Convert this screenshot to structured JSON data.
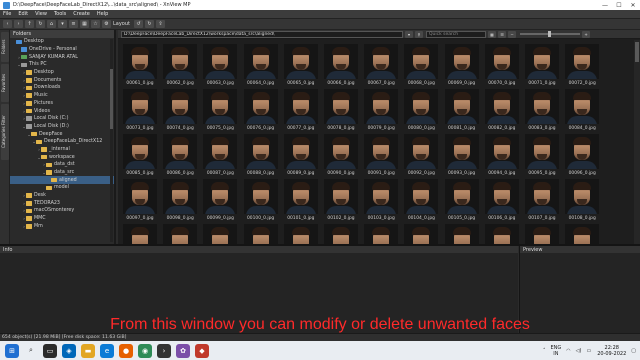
{
  "window": {
    "title": "D:\\DeepFace\\DeepFaceLab_DirectX12\\...\\data_src\\aligned\\ - XnView MP",
    "minimize": "—",
    "maximize": "☐",
    "close": "✕"
  },
  "app_tab": "Browser",
  "menu": [
    "File",
    "Edit",
    "View",
    "Tools",
    "Create",
    "Help"
  ],
  "toolbar": {
    "layout_label": "Layout"
  },
  "side_tabs": [
    "Folders",
    "Favorites",
    "Categories Filter"
  ],
  "folders_panel": {
    "title": "Folders",
    "tree": [
      {
        "label": "Desktop",
        "level": 0,
        "icon": "desktop-icon",
        "arrow": "",
        "selected": false
      },
      {
        "label": "OneDrive - Personal",
        "level": 1,
        "icon": "cloud-icon",
        "arrow": "",
        "selected": false
      },
      {
        "label": "SANJAY KUMAR ATAL",
        "level": 1,
        "icon": "user-folder-icon",
        "arrow": "›",
        "selected": false
      },
      {
        "label": "This PC",
        "level": 1,
        "icon": "computer-icon",
        "arrow": "⌄",
        "selected": false
      },
      {
        "label": "Desktop",
        "level": 2,
        "icon": "folder-icon",
        "arrow": "›",
        "selected": false
      },
      {
        "label": "Documents",
        "level": 2,
        "icon": "folder-icon",
        "arrow": "›",
        "selected": false
      },
      {
        "label": "Downloads",
        "level": 2,
        "icon": "folder-icon",
        "arrow": "›",
        "selected": false
      },
      {
        "label": "Music",
        "level": 2,
        "icon": "folder-icon",
        "arrow": "›",
        "selected": false
      },
      {
        "label": "Pictures",
        "level": 2,
        "icon": "folder-icon",
        "arrow": "›",
        "selected": false
      },
      {
        "label": "Videos",
        "level": 2,
        "icon": "folder-icon",
        "arrow": "›",
        "selected": false
      },
      {
        "label": "Local Disk (C:)",
        "level": 2,
        "icon": "drive-icon",
        "arrow": "›",
        "selected": false
      },
      {
        "label": "Local Disk (D:)",
        "level": 2,
        "icon": "drive-icon",
        "arrow": "⌄",
        "selected": false
      },
      {
        "label": "DeepFace",
        "level": 3,
        "icon": "folder-icon",
        "arrow": "⌄",
        "selected": false
      },
      {
        "label": "DeepFaceLab_DirectX12",
        "level": 4,
        "icon": "folder-icon",
        "arrow": "⌄",
        "selected": false
      },
      {
        "label": "_internal",
        "level": 5,
        "icon": "folder-icon",
        "arrow": "›",
        "selected": false
      },
      {
        "label": "workspace",
        "level": 5,
        "icon": "folder-icon",
        "arrow": "⌄",
        "selected": false
      },
      {
        "label": "data_dst",
        "level": 6,
        "icon": "folder-icon",
        "arrow": "›",
        "selected": false
      },
      {
        "label": "data_src",
        "level": 6,
        "icon": "folder-icon",
        "arrow": "⌄",
        "selected": false
      },
      {
        "label": "aligned",
        "level": 7,
        "icon": "folder-icon",
        "arrow": "",
        "selected": true
      },
      {
        "label": "model",
        "level": 6,
        "icon": "folder-icon",
        "arrow": "",
        "selected": false
      },
      {
        "label": "Desk",
        "level": 2,
        "icon": "folder-icon",
        "arrow": "›",
        "selected": false
      },
      {
        "label": "TEDORA23",
        "level": 2,
        "icon": "folder-icon",
        "arrow": "›",
        "selected": false
      },
      {
        "label": "macOSmonterey",
        "level": 2,
        "icon": "folder-icon",
        "arrow": "›",
        "selected": false
      },
      {
        "label": "MMC",
        "level": 2,
        "icon": "folder-icon",
        "arrow": "›",
        "selected": false
      },
      {
        "label": "Mm",
        "level": 2,
        "icon": "folder-icon",
        "arrow": "›",
        "selected": false
      }
    ]
  },
  "path_bar": {
    "path": "D:\\DeepFace\\DeepFaceLab_DirectX12\\workspace\\data_src\\aligned\\",
    "quick_search_placeholder": "Quick search"
  },
  "thumbnails": [
    "00061_0.jpg",
    "00062_0.jpg",
    "00063_0.jpg",
    "00064_0.jpg",
    "00065_0.jpg",
    "00066_0.jpg",
    "00067_0.jpg",
    "00068_0.jpg",
    "00069_0.jpg",
    "00070_0.jpg",
    "00071_0.jpg",
    "00072_0.jpg",
    "00073_0.jpg",
    "00074_0.jpg",
    "00075_0.jpg",
    "00076_0.jpg",
    "00077_0.jpg",
    "00078_0.jpg",
    "00079_0.jpg",
    "00080_0.jpg",
    "00081_0.jpg",
    "00082_0.jpg",
    "00083_0.jpg",
    "00084_0.jpg",
    "00085_0.jpg",
    "00086_0.jpg",
    "00087_0.jpg",
    "00088_0.jpg",
    "00089_0.jpg",
    "00090_0.jpg",
    "00091_0.jpg",
    "00092_0.jpg",
    "00093_0.jpg",
    "00094_0.jpg",
    "00095_0.jpg",
    "00096_0.jpg",
    "00097_0.jpg",
    "00098_0.jpg",
    "00099_0.jpg",
    "00100_0.jpg",
    "00101_0.jpg",
    "00102_0.jpg",
    "00103_0.jpg",
    "00104_0.jpg",
    "00105_0.jpg",
    "00106_0.jpg",
    "00107_0.jpg",
    "00108_0.jpg",
    "",
    "",
    "",
    "",
    "",
    "",
    "",
    "",
    "",
    "",
    "",
    ""
  ],
  "info_panel": {
    "title": "Info"
  },
  "preview_panel": {
    "title": "Preview"
  },
  "caption": "From this window you can modify or delete unwanted faces",
  "status_bar": "654 object(s) [21.98 MiB] [Free disk space: 11.63 GiB]",
  "taskbar": {
    "tray_lang": "ENG",
    "tray_region": "IN",
    "time": "22:28",
    "date": "20-09-2022"
  }
}
